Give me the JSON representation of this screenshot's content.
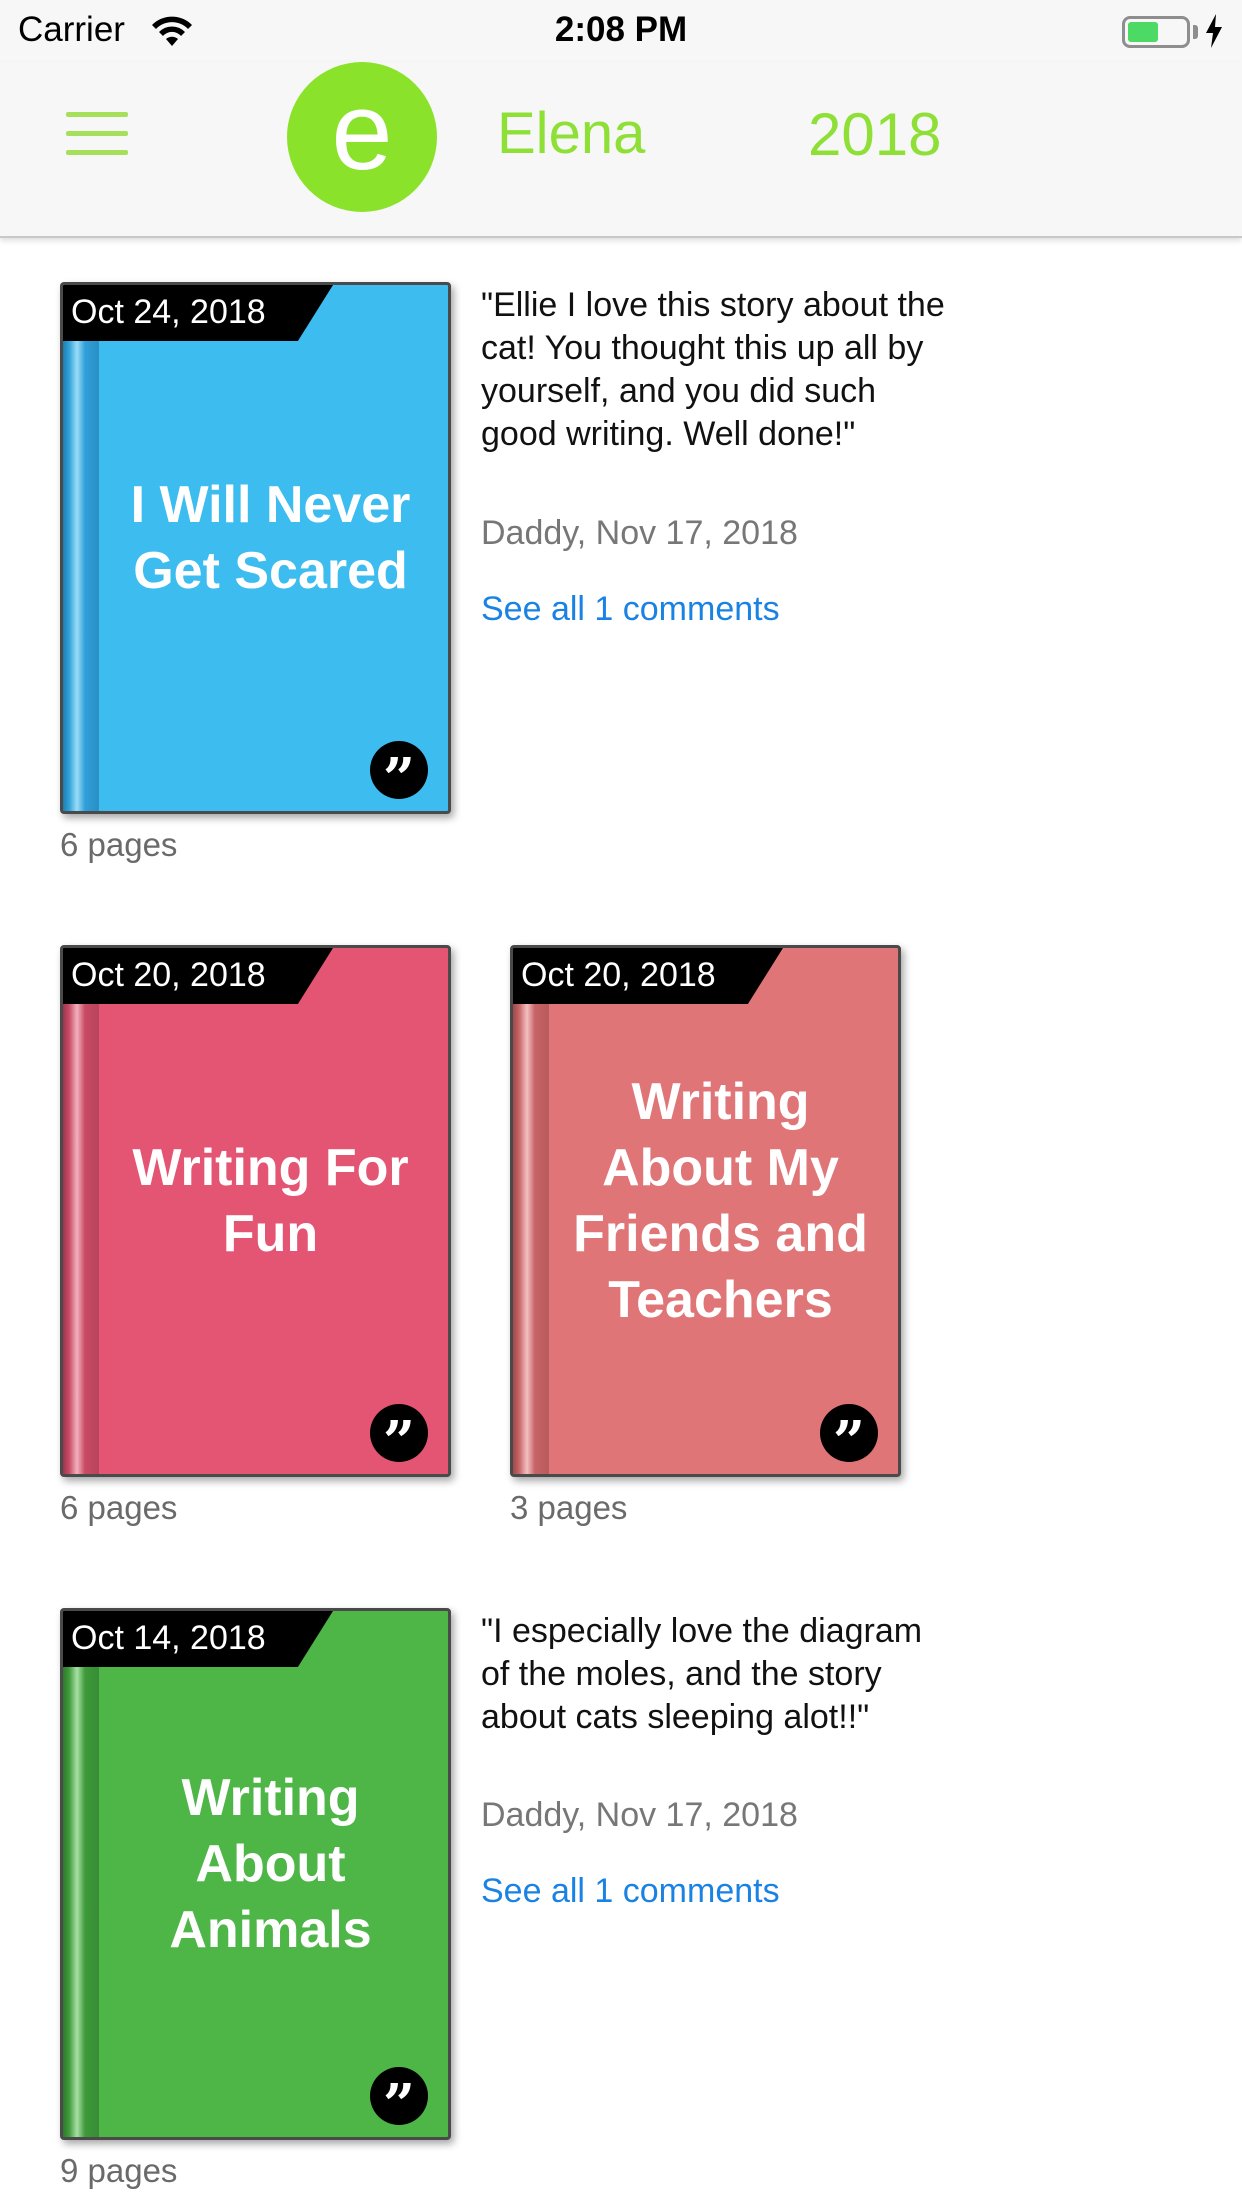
{
  "status_bar": {
    "carrier": "Carrier",
    "time": "2:08 PM"
  },
  "header": {
    "avatar_letter": "e",
    "name": "Elena",
    "year": "2018",
    "accent_color": "#8ee036"
  },
  "books": [
    {
      "date": "Oct 24, 2018",
      "title": "I Will Never Get Scared",
      "pages": "6 pages",
      "cover_color": "#3dbcf0",
      "spine_color": "#2fa0d8",
      "comment": {
        "text": "\"Ellie I love this story about the cat! You thought this up all by yourself, and you did such good writing. Well done!\"",
        "meta": "Daddy, Nov 17, 2018",
        "link": "See all 1 comments"
      }
    },
    {
      "date": "Oct 20, 2018",
      "title": "Writing For Fun",
      "pages": "6 pages",
      "cover_color": "#e45573",
      "spine_color": "#c84a63"
    },
    {
      "date": "Oct 20, 2018",
      "title": "Writing About My Friends and Teachers",
      "pages": "3 pages",
      "cover_color": "#e07577",
      "spine_color": "#c66366"
    },
    {
      "date": "Oct 14, 2018",
      "title": "Writing About Animals",
      "pages": "9 pages",
      "cover_color": "#4db647",
      "spine_color": "#3e9a3a",
      "comment": {
        "text": "\"I especially love the diagram of the moles, and the story about cats sleeping alot!!\"",
        "meta": "Daddy, Nov 17, 2018",
        "link": "See all 1 comments"
      }
    }
  ]
}
